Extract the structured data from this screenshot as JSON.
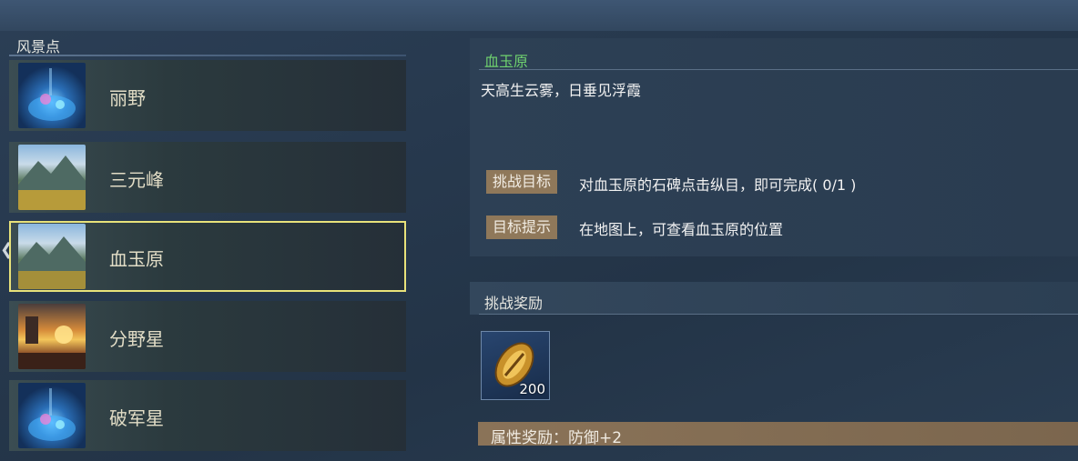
{
  "scenic": {
    "title": "风景点",
    "items": [
      {
        "name": "丽野",
        "thumb": "starry-scene"
      },
      {
        "name": "三元峰",
        "thumb": "mountain-scene"
      },
      {
        "name": "血玉原",
        "thumb": "mountain-scene",
        "selected": true
      },
      {
        "name": "分野星",
        "thumb": "sunset-scene"
      },
      {
        "name": "破军星",
        "thumb": "starry-scene"
      }
    ]
  },
  "detail": {
    "title": "血玉原",
    "description": "天高生云雾，日垂见浮霞",
    "goal_label": "挑战目标",
    "goal_text": "对血玉原的石碑点击纵目，即可完成( 0/1 )",
    "hint_label": "目标提示",
    "hint_text": "在地图上，可查看血玉原的位置"
  },
  "reward": {
    "title": "挑战奖励",
    "item_icon": "gold-shell-icon",
    "item_count": "200",
    "attribute": "属性奖励：防御+2"
  },
  "colors": {
    "title_green": "#6fd16f",
    "selected_border": "#e8e27a",
    "tag_bg": "#8f785a"
  }
}
